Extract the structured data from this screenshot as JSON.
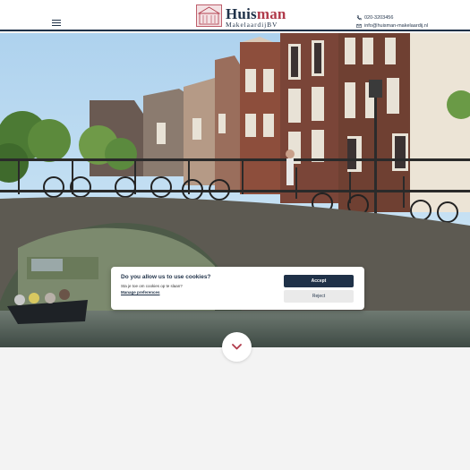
{
  "header": {
    "logo": {
      "title_main": "Huis",
      "title_accent": "man",
      "subtitle": "MakelaardijBV"
    },
    "contact": {
      "phone": "020-3203456",
      "email": "info@huisman-makelaardij.nl"
    }
  },
  "hero": {
    "scroll_icon": "chevron-down-icon"
  },
  "cookie_banner": {
    "title": "Do you allow us to use cookies?",
    "text": "Sta je toe om cookies op te slaan?",
    "manage_link": "Manage preferences",
    "accept_label": "Accept",
    "reject_label": "Reject"
  },
  "colors": {
    "brand_navy": "#1f3148",
    "brand_red": "#b03a4a",
    "page_background": "#f3f3f3"
  }
}
